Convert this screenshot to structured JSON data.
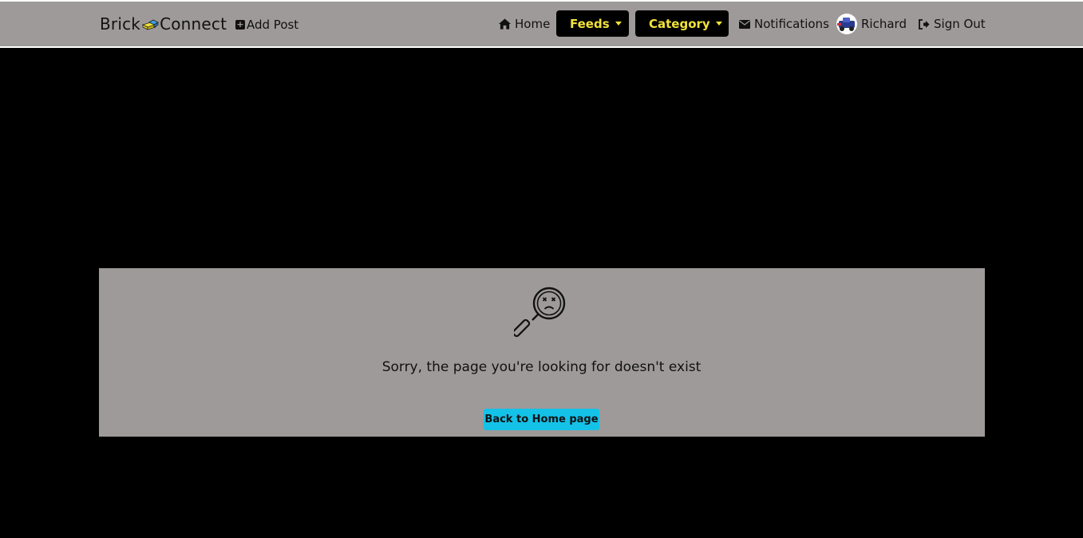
{
  "navbar": {
    "brand_left": "Brick",
    "brand_right": "Connect",
    "add_post": "Add Post",
    "home": "Home",
    "feeds": "Feeds",
    "category": "Category",
    "notifications": "Notifications",
    "user_name": "Richard",
    "sign_out": "Sign Out"
  },
  "main": {
    "message": "Sorry, the page you're looking for doesn't exist",
    "back_button": "Back to Home page"
  },
  "colors": {
    "navbar_bg": "#9e9a99",
    "dropdown_bg": "#000000",
    "dropdown_text": "#f1e33a",
    "button_bg": "#14c2e8"
  },
  "icons": {
    "home": "home-icon",
    "feeds": "bars-icon",
    "category": "layers-icon",
    "notifications": "envelope-icon",
    "sign_out": "sign-out-icon",
    "not_found": "magnifier-sad-face-icon"
  }
}
